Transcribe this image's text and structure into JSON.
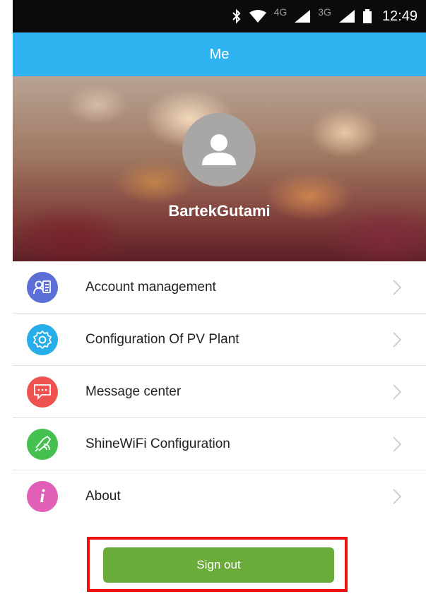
{
  "status_bar": {
    "time": "12:49",
    "network_1": "4G",
    "network_2": "3G",
    "icons": [
      "bluetooth-icon",
      "wifi-icon",
      "signal-icon",
      "signal-icon",
      "battery-icon"
    ]
  },
  "header": {
    "title": "Me"
  },
  "profile": {
    "username": "BartekGutami",
    "avatar_icon": "user-icon"
  },
  "menu": {
    "items": [
      {
        "label": "Account management",
        "icon": "account-card-icon",
        "color": "#5b6fd6"
      },
      {
        "label": "Configuration Of PV Plant",
        "icon": "gear-icon",
        "color": "#27aee9"
      },
      {
        "label": "Message center",
        "icon": "message-icon",
        "color": "#ef5350"
      },
      {
        "label": "ShineWiFi Configuration",
        "icon": "wifi-plug-icon",
        "color": "#43c04f"
      },
      {
        "label": "About",
        "icon": "info-icon",
        "color": "#e25fb7"
      }
    ]
  },
  "actions": {
    "sign_out_label": "Sign out",
    "button_color": "#6aac3a",
    "highlight_color": "#ee1111"
  }
}
